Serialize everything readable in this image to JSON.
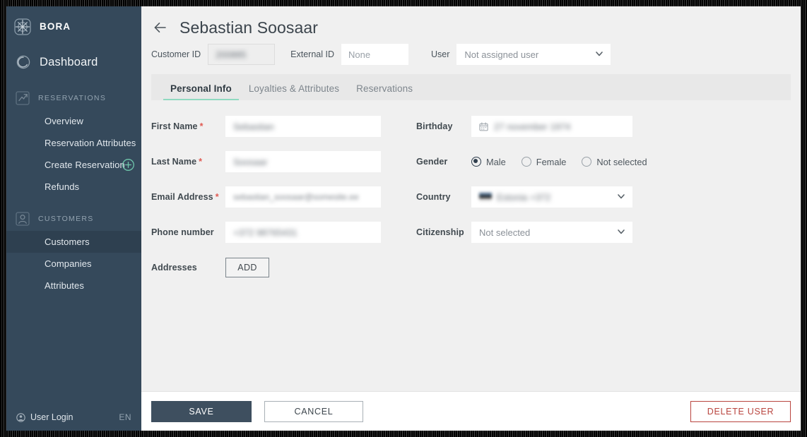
{
  "sidebar": {
    "brand": {
      "name": "BORA",
      "icon": "compass-logo-icon"
    },
    "dashboard": {
      "label": "Dashboard",
      "icon": "dashboard-circle-icon"
    },
    "sections": [
      {
        "label": "RESERVATIONS",
        "icon": "chart-square-icon",
        "items": [
          {
            "label": "Overview",
            "active": false
          },
          {
            "label": "Reservation Attributes",
            "active": false
          },
          {
            "label": "Create Reservation",
            "active": false,
            "trailing_icon": "plus-circle-icon"
          },
          {
            "label": "Refunds",
            "active": false
          }
        ]
      },
      {
        "label": "CUSTOMERS",
        "icon": "user-square-icon",
        "items": [
          {
            "label": "Customers",
            "active": true
          },
          {
            "label": "Companies",
            "active": false
          },
          {
            "label": "Attributes",
            "active": false
          }
        ]
      }
    ],
    "footer": {
      "user_label": "User Login",
      "user_icon": "user-circle-icon",
      "language": "EN"
    }
  },
  "header": {
    "back_icon": "arrow-left-icon",
    "title": "Sebastian Soosaar"
  },
  "id_row": {
    "customer_id_label": "Customer ID",
    "customer_id_value": "200885",
    "external_id_label": "External ID",
    "external_id_value": "",
    "external_id_placeholder": "None",
    "user_label": "User",
    "user_value": "Not assigned user",
    "user_caret_icon": "chevron-down-icon"
  },
  "tabs": [
    {
      "label": "Personal Info",
      "active": true
    },
    {
      "label": "Loyalties & Attributes",
      "active": false
    },
    {
      "label": "Reservations",
      "active": false
    }
  ],
  "form": {
    "left": {
      "first_name": {
        "label": "First Name",
        "required": "*",
        "value": "Sebastian"
      },
      "last_name": {
        "label": "Last Name",
        "required": "*",
        "value": "Soosaar"
      },
      "email": {
        "label": "Email Address",
        "required": "*",
        "value": "sebastian_soosaar@somesite.ee"
      },
      "phone": {
        "label": "Phone number",
        "value": "+372 98765431"
      },
      "addresses": {
        "label": "Addresses",
        "add_button": "ADD"
      }
    },
    "right": {
      "birthday": {
        "label": "Birthday",
        "icon": "calendar-icon",
        "value": "27 november 1974"
      },
      "gender": {
        "label": "Gender",
        "options": [
          {
            "label": "Male",
            "selected": true
          },
          {
            "label": "Female",
            "selected": false
          },
          {
            "label": "Not selected",
            "selected": false
          }
        ]
      },
      "country": {
        "label": "Country",
        "flag_icon": "flag-estonia-icon",
        "value": "Estonia +372",
        "caret_icon": "chevron-down-icon"
      },
      "citizenship": {
        "label": "Citizenship",
        "value": "Not selected",
        "caret_icon": "chevron-down-icon"
      }
    }
  },
  "footer": {
    "save": "SAVE",
    "cancel": "CANCEL",
    "delete": "DELETE USER"
  },
  "colors": {
    "sidebar_bg": "#35495b",
    "sidebar_active": "#2e4050",
    "accent_teal": "#8fd9c0",
    "page_bg": "#f0f0f0",
    "primary_btn": "#3e4f5f",
    "danger": "#b9453f",
    "required_star": "#e05a52"
  }
}
